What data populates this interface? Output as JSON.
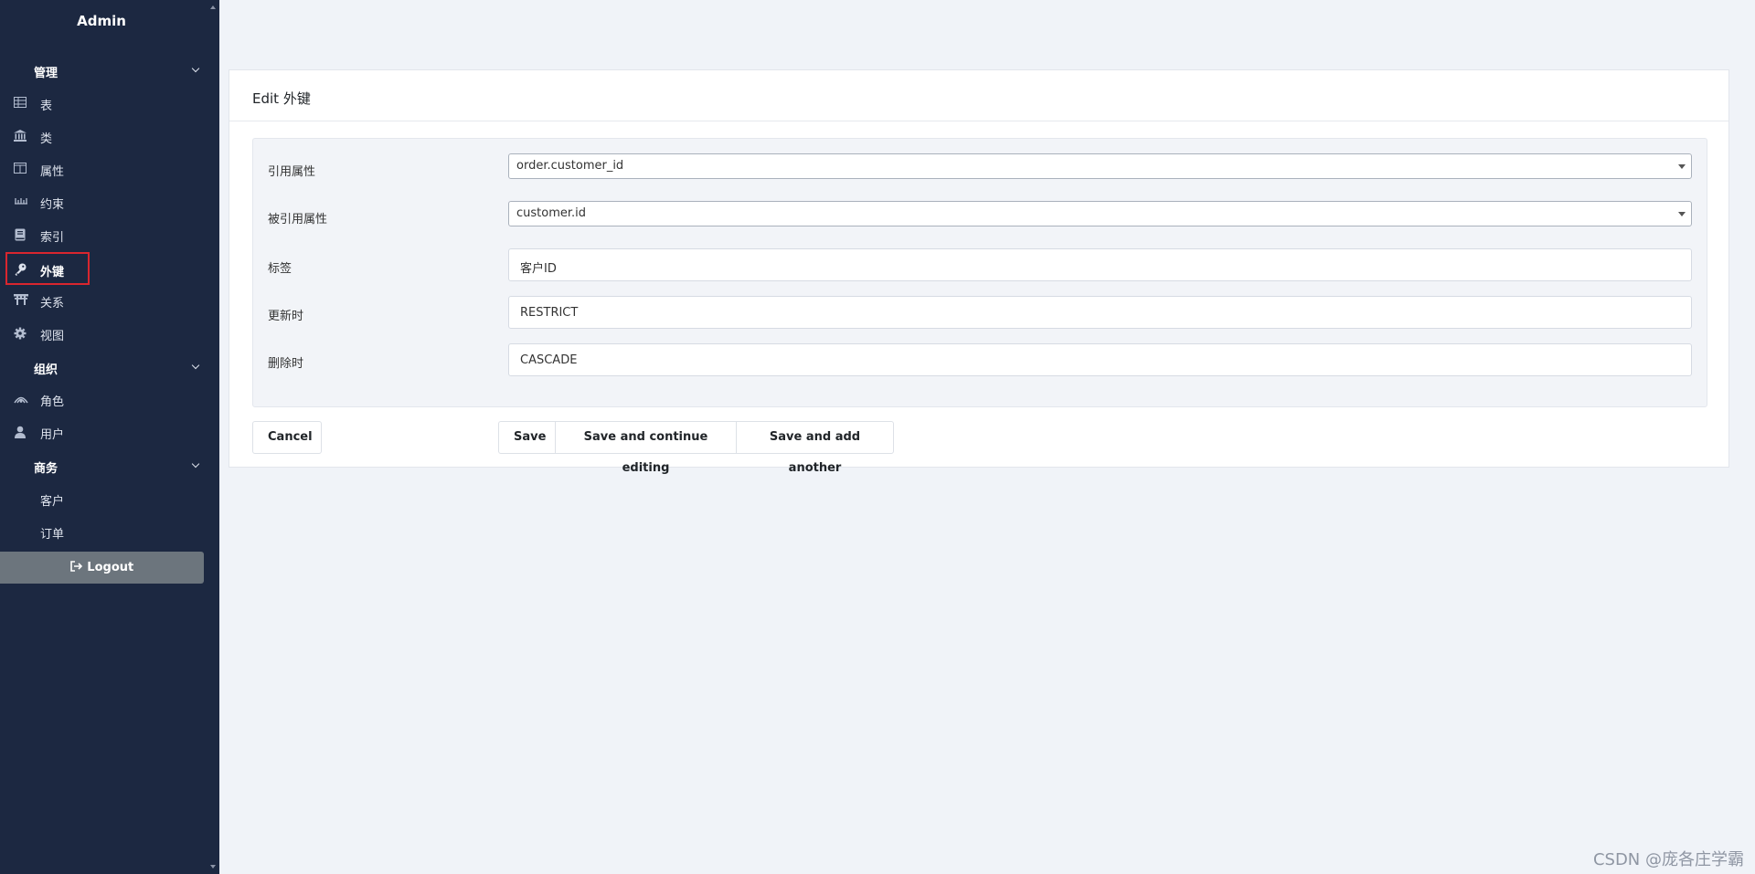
{
  "sidebar": {
    "brand": "Admin",
    "sections": [
      {
        "title": "管理",
        "items": [
          {
            "label": "表",
            "icon": "table-icon"
          },
          {
            "label": "类",
            "icon": "institution-icon"
          },
          {
            "label": "属性",
            "icon": "columns-icon"
          },
          {
            "label": "约束",
            "icon": "ruler-icon"
          },
          {
            "label": "索引",
            "icon": "book-icon"
          },
          {
            "label": "外键",
            "icon": "key-icon",
            "active": true
          },
          {
            "label": "关系",
            "icon": "torii-icon"
          },
          {
            "label": "视图",
            "icon": "cog-icon"
          }
        ]
      },
      {
        "title": "组织",
        "items": [
          {
            "label": "角色",
            "icon": "users-icon"
          },
          {
            "label": "用户",
            "icon": "user-icon"
          }
        ]
      },
      {
        "title": "商务",
        "items": [
          {
            "label": "客户"
          },
          {
            "label": "订单"
          }
        ]
      }
    ],
    "logout_label": "Logout"
  },
  "card": {
    "title": "Edit 外键",
    "fields": [
      {
        "label": "引用属性",
        "value": "order.customer_id",
        "type": "select"
      },
      {
        "label": "被引用属性",
        "value": "customer.id",
        "type": "select"
      },
      {
        "label": "标签",
        "value": "客户ID",
        "type": "text"
      },
      {
        "label": "更新时",
        "value": "RESTRICT",
        "type": "text"
      },
      {
        "label": "删除时",
        "value": "CASCADE",
        "type": "text"
      }
    ],
    "buttons": {
      "cancel": "Cancel",
      "save": "Save",
      "save_continue": "Save and continue editing",
      "save_add": "Save and add another"
    }
  },
  "watermark": "CSDN @庞各庄学霸",
  "colors": {
    "sidebar_bg": "#1c2841",
    "active_outline": "#d9262e",
    "page_bg": "#f0f3f8"
  }
}
